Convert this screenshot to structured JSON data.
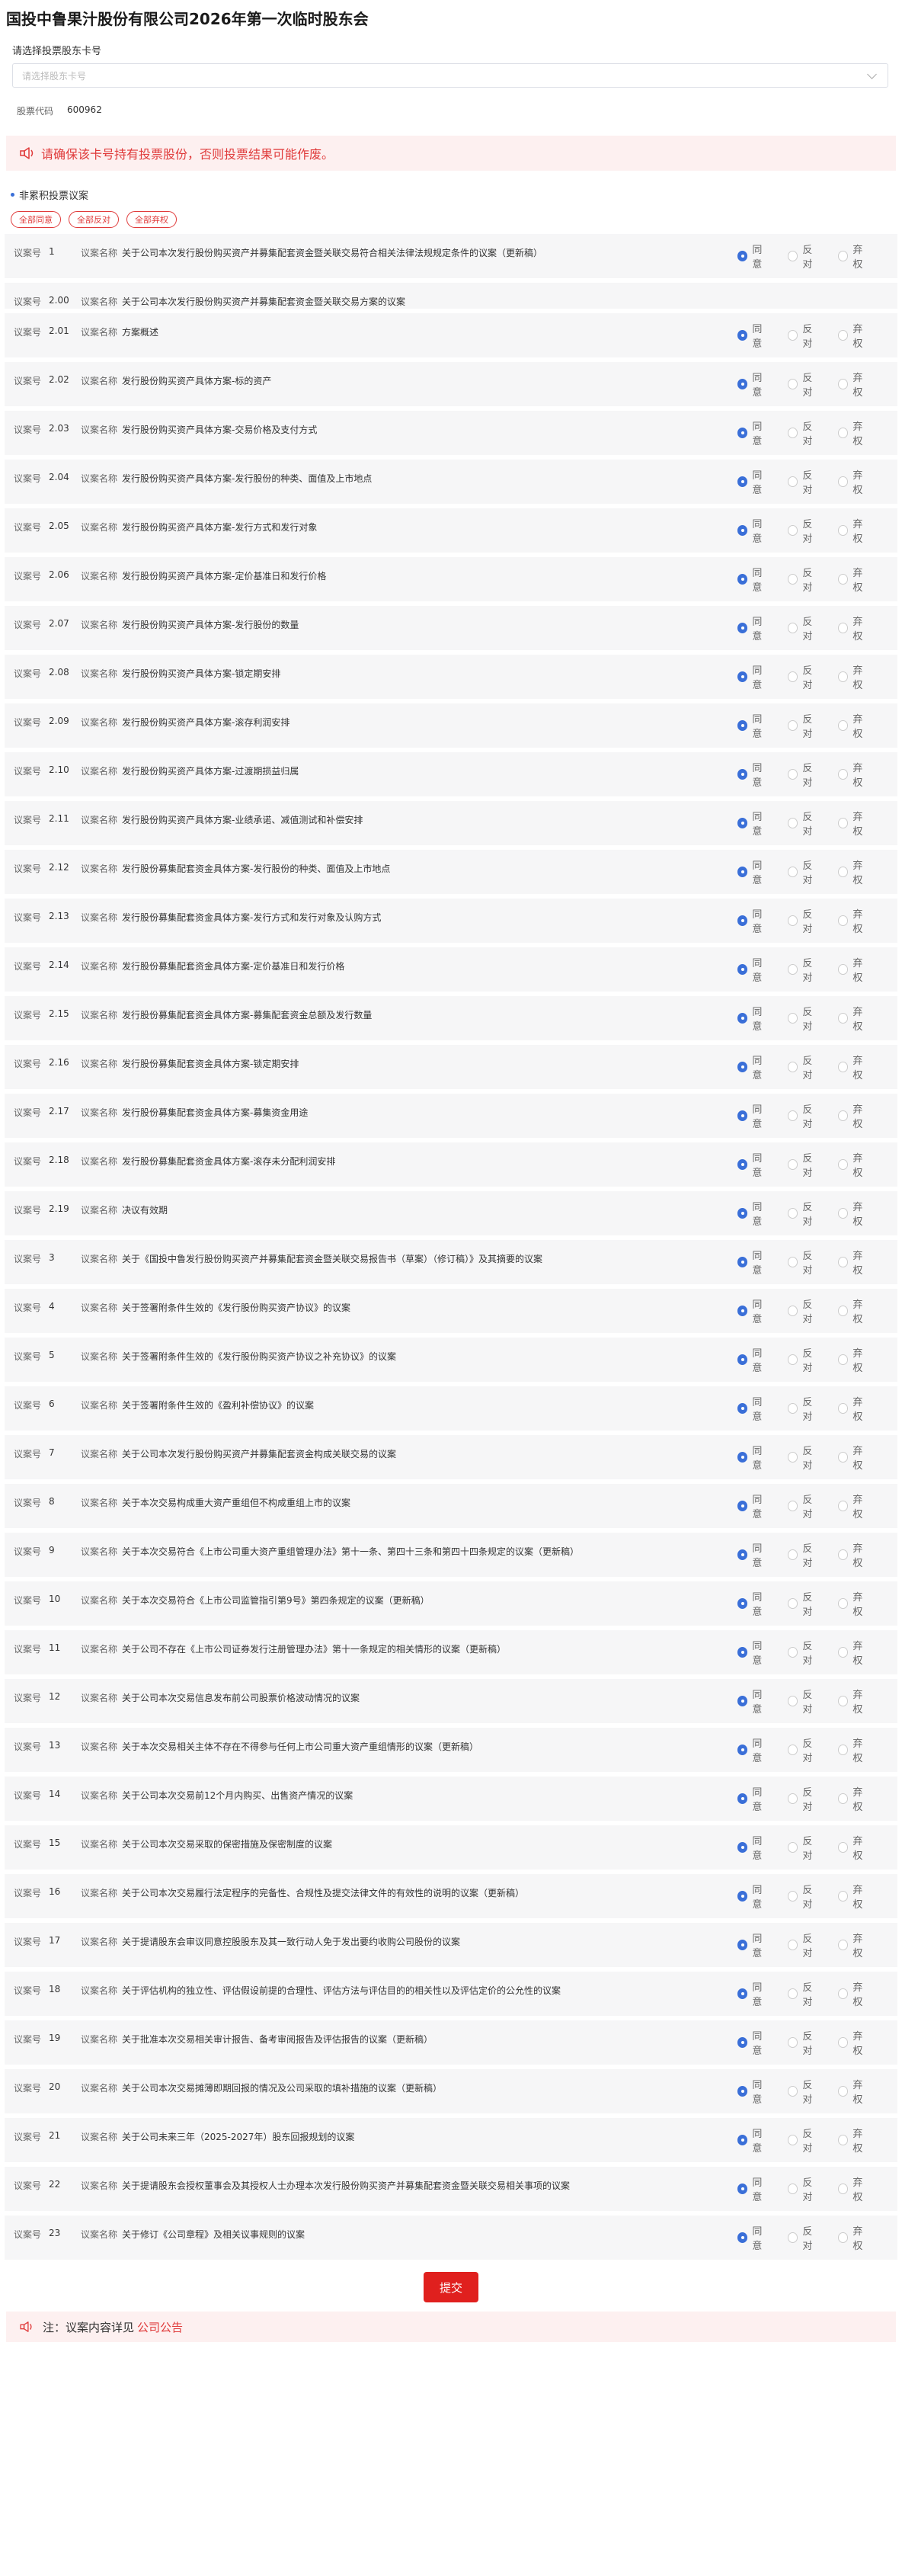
{
  "page_title": "国投中鲁果汁股份有限公司2026年第一次临时股东会",
  "account": {
    "label": "请选择投票股东卡号",
    "placeholder": "请选择股东卡号"
  },
  "stock": {
    "label": "股票代码",
    "code": "600962"
  },
  "alert_text": "请确保该卡号持有投票股份，否则投票结果可能作废。",
  "section_title": "非累积投票议案",
  "bulk": {
    "agree_all": "全部同意",
    "oppose_all": "全部反对",
    "abstain_all": "全部弃权"
  },
  "labels": {
    "motion_no": "议案号",
    "motion_name": "议案名称"
  },
  "vote_options": {
    "agree": "同意",
    "oppose": "反对",
    "abstain": "弃权"
  },
  "motions": [
    {
      "no": "1",
      "name": "关于公司本次发行股份购买资产并募集配套资金暨关联交易符合相关法律法规规定条件的议案（更新稿）",
      "has_vote": true
    },
    {
      "no": "2.00",
      "name": "关于公司本次发行股份购买资产并募集配套资金暨关联交易方案的议案",
      "has_vote": false
    },
    {
      "no": "2.01",
      "name": "方案概述",
      "has_vote": true
    },
    {
      "no": "2.02",
      "name": "发行股份购买资产具体方案-标的资产",
      "has_vote": true
    },
    {
      "no": "2.03",
      "name": "发行股份购买资产具体方案-交易价格及支付方式",
      "has_vote": true
    },
    {
      "no": "2.04",
      "name": "发行股份购买资产具体方案-发行股份的种类、面值及上市地点",
      "has_vote": true
    },
    {
      "no": "2.05",
      "name": "发行股份购买资产具体方案-发行方式和发行对象",
      "has_vote": true
    },
    {
      "no": "2.06",
      "name": "发行股份购买资产具体方案-定价基准日和发行价格",
      "has_vote": true
    },
    {
      "no": "2.07",
      "name": "发行股份购买资产具体方案-发行股份的数量",
      "has_vote": true
    },
    {
      "no": "2.08",
      "name": "发行股份购买资产具体方案-锁定期安排",
      "has_vote": true
    },
    {
      "no": "2.09",
      "name": "发行股份购买资产具体方案-滚存利润安排",
      "has_vote": true
    },
    {
      "no": "2.10",
      "name": "发行股份购买资产具体方案-过渡期损益归属",
      "has_vote": true
    },
    {
      "no": "2.11",
      "name": "发行股份购买资产具体方案-业绩承诺、减值测试和补偿安排",
      "has_vote": true
    },
    {
      "no": "2.12",
      "name": "发行股份募集配套资金具体方案-发行股份的种类、面值及上市地点",
      "has_vote": true
    },
    {
      "no": "2.13",
      "name": "发行股份募集配套资金具体方案-发行方式和发行对象及认购方式",
      "has_vote": true
    },
    {
      "no": "2.14",
      "name": "发行股份募集配套资金具体方案-定价基准日和发行价格",
      "has_vote": true
    },
    {
      "no": "2.15",
      "name": "发行股份募集配套资金具体方案-募集配套资金总额及发行数量",
      "has_vote": true
    },
    {
      "no": "2.16",
      "name": "发行股份募集配套资金具体方案-锁定期安排",
      "has_vote": true
    },
    {
      "no": "2.17",
      "name": "发行股份募集配套资金具体方案-募集资金用途",
      "has_vote": true
    },
    {
      "no": "2.18",
      "name": "发行股份募集配套资金具体方案-滚存未分配利润安排",
      "has_vote": true
    },
    {
      "no": "2.19",
      "name": "决议有效期",
      "has_vote": true
    },
    {
      "no": "3",
      "name": "关于《国投中鲁发行股份购买资产并募集配套资金暨关联交易报告书（草案）（修订稿）》及其摘要的议案",
      "has_vote": true
    },
    {
      "no": "4",
      "name": "关于签署附条件生效的《发行股份购买资产协议》的议案",
      "has_vote": true
    },
    {
      "no": "5",
      "name": "关于签署附条件生效的《发行股份购买资产协议之补充协议》的议案",
      "has_vote": true
    },
    {
      "no": "6",
      "name": "关于签署附条件生效的《盈利补偿协议》的议案",
      "has_vote": true
    },
    {
      "no": "7",
      "name": "关于公司本次发行股份购买资产并募集配套资金构成关联交易的议案",
      "has_vote": true
    },
    {
      "no": "8",
      "name": "关于本次交易构成重大资产重组但不构成重组上市的议案",
      "has_vote": true
    },
    {
      "no": "9",
      "name": "关于本次交易符合《上市公司重大资产重组管理办法》第十一条、第四十三条和第四十四条规定的议案（更新稿）",
      "has_vote": true
    },
    {
      "no": "10",
      "name": "关于本次交易符合《上市公司监管指引第9号》第四条规定的议案（更新稿）",
      "has_vote": true
    },
    {
      "no": "11",
      "name": "关于公司不存在《上市公司证券发行注册管理办法》第十一条规定的相关情形的议案（更新稿）",
      "has_vote": true
    },
    {
      "no": "12",
      "name": "关于公司本次交易信息发布前公司股票价格波动情况的议案",
      "has_vote": true
    },
    {
      "no": "13",
      "name": "关于本次交易相关主体不存在不得参与任何上市公司重大资产重组情形的议案（更新稿）",
      "has_vote": true
    },
    {
      "no": "14",
      "name": "关于公司本次交易前12个月内购买、出售资产情况的议案",
      "has_vote": true
    },
    {
      "no": "15",
      "name": "关于公司本次交易采取的保密措施及保密制度的议案",
      "has_vote": true
    },
    {
      "no": "16",
      "name": "关于公司本次交易履行法定程序的完备性、合规性及提交法律文件的有效性的说明的议案（更新稿）",
      "has_vote": true
    },
    {
      "no": "17",
      "name": "关于提请股东会审议同意控股股东及其一致行动人免于发出要约收购公司股份的议案",
      "has_vote": true
    },
    {
      "no": "18",
      "name": "关于评估机构的独立性、评估假设前提的合理性、评估方法与评估目的的相关性以及评估定价的公允性的议案",
      "has_vote": true
    },
    {
      "no": "19",
      "name": "关于批准本次交易相关审计报告、备考审阅报告及评估报告的议案（更新稿）",
      "has_vote": true
    },
    {
      "no": "20",
      "name": "关于公司本次交易摊薄即期回报的情况及公司采取的填补措施的议案（更新稿）",
      "has_vote": true
    },
    {
      "no": "21",
      "name": "关于公司未来三年（2025-2027年）股东回报规划的议案",
      "has_vote": true
    },
    {
      "no": "22",
      "name": "关于提请股东会授权董事会及其授权人士办理本次发行股份购买资产并募集配套资金暨关联交易相关事项的议案",
      "has_vote": true
    },
    {
      "no": "23",
      "name": "关于修订《公司章程》及相关议事规则的议案",
      "has_vote": true
    }
  ],
  "submit_label": "提交",
  "note": {
    "prefix": "注：",
    "text": "议案内容详见",
    "link": "公司公告"
  },
  "colors": {
    "accent_red": "#e0201e",
    "radio_blue": "#3a6fd8",
    "alert_bg": "#fdf0f0"
  }
}
